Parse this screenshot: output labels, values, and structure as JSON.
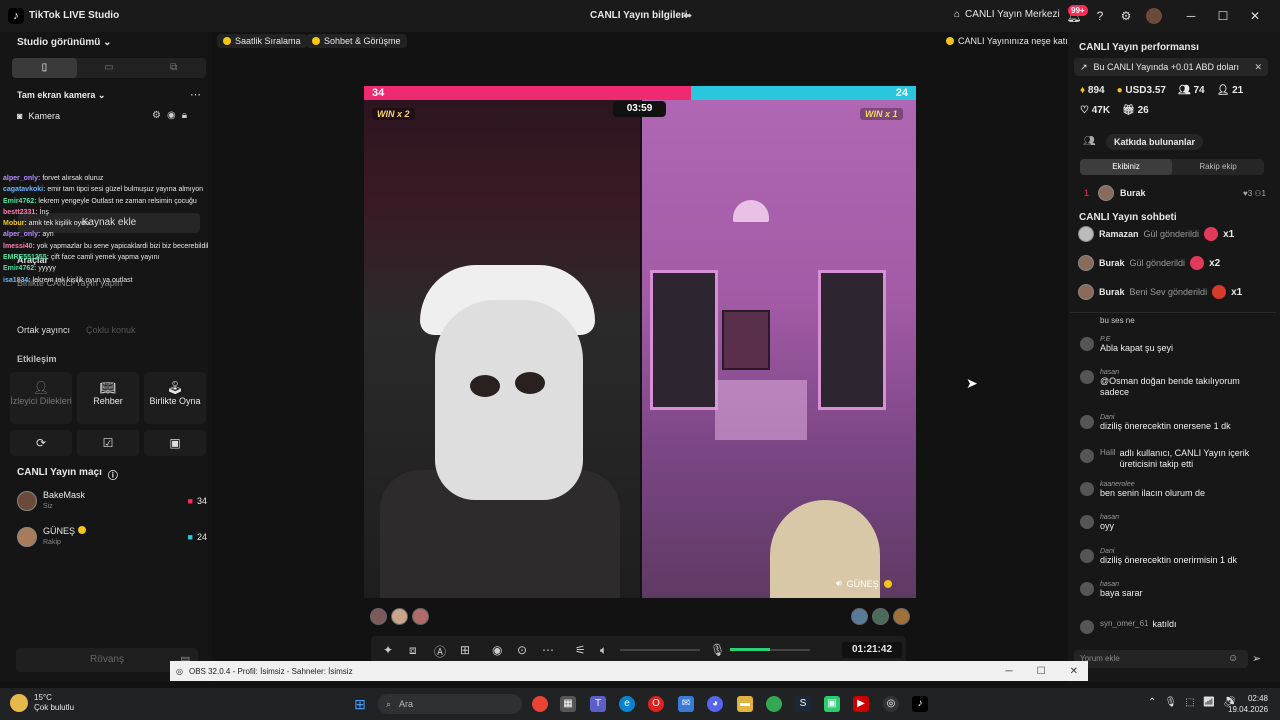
{
  "titlebar": {
    "app_logo": "♪",
    "app_name": "TikTok LIVE Studio",
    "center_title": "CANLI Yayın bilgileri",
    "live_center": "CANLI Yayın Merkezi",
    "notif_badge": "99+"
  },
  "left": {
    "studio_view": "Studio görünümü",
    "full_screen_camera": "Tam ekran kamera",
    "camera": "Kamera",
    "add_source": "Kaynak ekle",
    "tools": "Araçlar",
    "collab_live": "Birlikte CANLI Yayın yapın",
    "co_host": "Ortak yayıncı",
    "multi_guest": "Çoklu konuk",
    "interaction": "Etkileşim",
    "tile_requests": "İzleyici Dilekleri",
    "tile_guide": "Rehber",
    "tile_play": "Birlikte Oyna",
    "match_title": "CANLI Yayın maçı",
    "players": [
      {
        "name": "BakeMask",
        "role": "Siz",
        "score": "34"
      },
      {
        "name": "GÜNEŞ",
        "role": "Rakip",
        "score": "24"
      }
    ],
    "rematch": "Rövanş",
    "overlay_chat": [
      {
        "user": "alper_only:",
        "text": "forvet alırsak oluruz",
        "color": "#b58cff"
      },
      {
        "user": "cagatavkoki:",
        "text": "emir tam tipci sesi güzel bulmuşuz yayına almıyon",
        "color": "#6fb6ff"
      },
      {
        "user": "Emir4762:",
        "text": "lekrem yengeyle Outlast ne zaman relsimin çocuğu",
        "color": "#54e0a0"
      },
      {
        "user": "bestt2331:",
        "text": "İnş",
        "color": "#ff7fb0"
      },
      {
        "user": "Mobur:",
        "text": "amk tek kişilik oyun",
        "color": "#f5c518"
      },
      {
        "user": "alper_only:",
        "text": "ayn",
        "color": "#b58cff"
      },
      {
        "user": "lmessi40:",
        "text": "yok yapmazlar bu sene yapicaklardi bizi biz becerebildik",
        "color": "#ff7fb0"
      },
      {
        "user": "EMRE551255:",
        "text": "çift face camli yemek yapma yayını",
        "color": "#54e0a0"
      },
      {
        "user": "Emir4762:",
        "text": "yyyyy",
        "color": "#54e0a0"
      },
      {
        "user": "isa1834:",
        "text": "lekrem tek kişilik oyun ya outlast",
        "color": "#6fb6ff"
      }
    ]
  },
  "tags": {
    "hourly": "Saatlik Sıralama",
    "chat_meet": "Sohbet & Görüşme",
    "joy": "CANLI Yayınınıza neşe katın"
  },
  "battle": {
    "left_score": "34",
    "right_score": "24",
    "left_share": 0.5925,
    "timer": "03:59",
    "left_win": "WIN x 2",
    "right_win": "WIN x 1",
    "opponent_label": "GÜNEŞ",
    "elapsed": "01:21:42"
  },
  "right": {
    "perf_title": "CANLI Yayın performansı",
    "earnings": "Bu CANLI Yayında +0.01 ABD doları",
    "stat_diamonds": "894",
    "stat_usd": "USD3.57",
    "stat_viewers": "74",
    "stat_follows": "21",
    "stat_likes": "47K",
    "stat_gifters": "26",
    "contributors": "Katkıda bulunanlar",
    "tab_team": "Ekibiniz",
    "tab_rival": "Rakip ekip",
    "rank": {
      "pos": "1",
      "name": "Burak",
      "hearts": "3",
      "count": "1"
    },
    "chat_title": "CANLI Yayın sohbeti",
    "gifts": [
      {
        "name": "Ramazan",
        "action": "Gül gönderildi",
        "qty": "x1"
      },
      {
        "name": "Burak",
        "action": "Gül gönderildi",
        "qty": "x2"
      },
      {
        "name": "Burak",
        "action": "Beni Sev gönderildi",
        "qty": "x1"
      }
    ],
    "chat_top": "bu ses ne",
    "messages": [
      {
        "name": "P.E",
        "text": "Abla kapat şu şeyi"
      },
      {
        "name": "hasan",
        "text": "@Osman doğan bende takılıyorum sadece"
      },
      {
        "name": "Dani",
        "text": "diziliş önerecektin onersene 1 dk"
      },
      {
        "name": "Halil",
        "text": "adlı kullanıcı, CANLI Yayın içerik üreticisini takip etti"
      },
      {
        "name": "kaanerolee",
        "text": "ben senin ilacın olurum de"
      },
      {
        "name": "hasan",
        "text": "oyy"
      },
      {
        "name": "Dani",
        "text": "diziliş önerecektin onerirmisin 1 dk"
      },
      {
        "name": "hasan",
        "text": "baya sarar"
      },
      {
        "name": "syn_omer_61",
        "text": "katıldı"
      }
    ],
    "comment_placeholder": "Yorum ekle"
  },
  "obs": {
    "title": "OBS 32.0.4 - Profil: İsimsiz - Sahneler: İsimsiz"
  },
  "taskbar": {
    "temp": "15°C",
    "weather": "Çok bulutlu",
    "search": "Ara",
    "time": "02:48",
    "date": "19.04.2026"
  }
}
